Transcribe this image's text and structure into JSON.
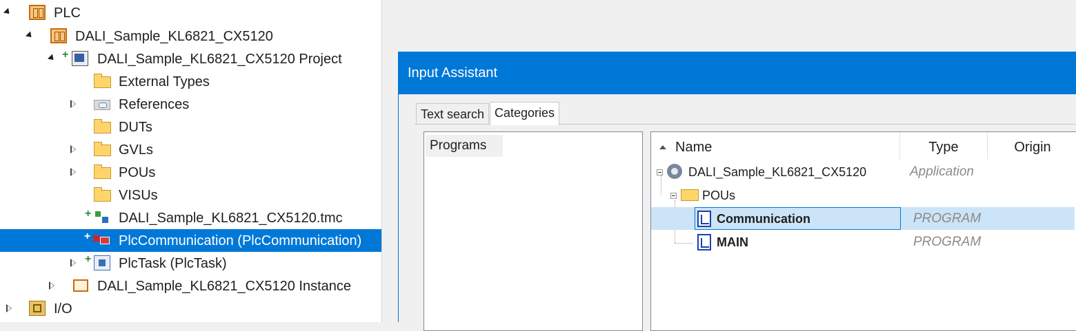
{
  "tree": {
    "items": [
      {
        "label": "PLC"
      },
      {
        "label": "DALI_Sample_KL6821_CX5120"
      },
      {
        "label": "DALI_Sample_KL6821_CX5120 Project"
      },
      {
        "label": "External Types"
      },
      {
        "label": "References"
      },
      {
        "label": "DUTs"
      },
      {
        "label": "GVLs"
      },
      {
        "label": "POUs"
      },
      {
        "label": "VISUs"
      },
      {
        "label": "DALI_Sample_KL6821_CX5120.tmc"
      },
      {
        "label": "PlcCommunication (PlcCommunication)"
      },
      {
        "label": "PlcTask (PlcTask)"
      },
      {
        "label": "DALI_Sample_KL6821_CX5120 Instance"
      },
      {
        "label": "I/O"
      }
    ],
    "selected_color": "#0078d7"
  },
  "dialog": {
    "title": "Input Assistant",
    "tabs": [
      {
        "label": "Text search"
      },
      {
        "label": "Categories"
      }
    ],
    "active_tab": "Categories",
    "categories": [
      {
        "label": "Programs"
      }
    ],
    "columns": {
      "name": "Name",
      "type": "Type",
      "origin": "Origin"
    },
    "rows": [
      {
        "name": "DALI_Sample_KL6821_CX5120",
        "type": "Application",
        "icon": "gear-icon"
      },
      {
        "name": "POUs",
        "type": "",
        "icon": "folder-icon"
      },
      {
        "name": "Communication",
        "type": "PROGRAM",
        "icon": "program-icon",
        "selected": true
      },
      {
        "name": "MAIN",
        "type": "PROGRAM",
        "icon": "program-icon"
      }
    ]
  }
}
